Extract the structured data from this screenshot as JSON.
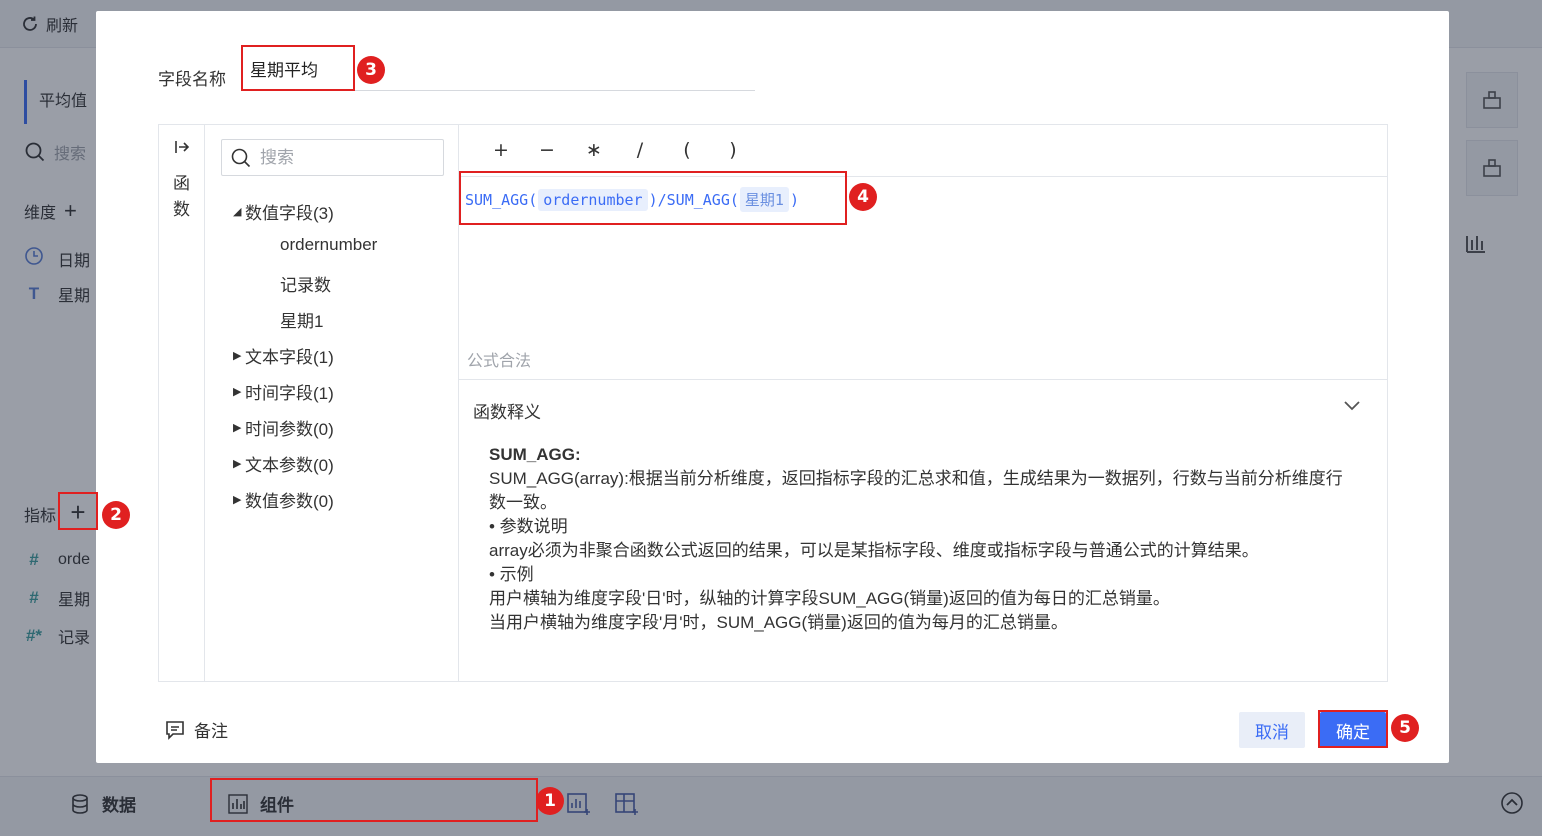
{
  "background": {
    "refresh_label": "刷新",
    "tab_label": "平均值",
    "search_placeholder": "搜索",
    "dimension_label": "维度",
    "dimension_fields": [
      {
        "icon": "clock-icon",
        "label": "日期"
      },
      {
        "icon": "text-type-icon",
        "label": "星期"
      }
    ],
    "measure_label": "指标",
    "measure_fields": [
      {
        "icon": "number-icon",
        "label": "orde"
      },
      {
        "icon": "number-icon",
        "label": "星期"
      },
      {
        "icon": "calc-number-icon",
        "label": "记录"
      }
    ],
    "bottom_data_label": "数据",
    "bottom_component_label": "组件"
  },
  "dialog": {
    "field_name_label": "字段名称",
    "field_name_value": "星期平均",
    "function_tab_label": "函数",
    "search_placeholder": "搜索",
    "tree": [
      {
        "label": "数值字段(3)",
        "expanded": true
      },
      {
        "label": "ordernumber"
      },
      {
        "label": "记录数"
      },
      {
        "label": "星期1"
      },
      {
        "label": "文本字段(1)"
      },
      {
        "label": "时间字段(1)"
      },
      {
        "label": "时间参数(0)"
      },
      {
        "label": "文本参数(0)"
      },
      {
        "label": "数值参数(0)"
      }
    ],
    "operators": [
      "+",
      "−",
      "∗",
      "/",
      "(",
      ")"
    ],
    "formula": {
      "fn1": "SUM_AGG(",
      "arg1": "ordernumber",
      "mid": ")/SUM_AGG(",
      "arg2": "星期1",
      "end": ")"
    },
    "formula_status": "公式合法",
    "explain_title": "函数释义",
    "explain": {
      "name": "SUM_AGG:",
      "line1": "SUM_AGG(array):根据当前分析维度，返回指标字段的汇总求和值，生成结果为一数据列，行数与当前分析维度行数一致。",
      "param_head": "• 参数说明",
      "param_text": "array必须为非聚合函数公式返回的结果，可以是某指标字段、维度或指标字段与普通公式的计算结果。",
      "example_head": "• 示例",
      "example1": "用户横轴为维度字段'日'时，纵轴的计算字段SUM_AGG(销量)返回的值为每日的汇总销量。",
      "example2": "当用户横轴为维度字段'月'时，SUM_AGG(销量)返回的值为每月的汇总销量。"
    },
    "note_label": "备注",
    "cancel_label": "取消",
    "ok_label": "确定"
  },
  "badges": [
    "1",
    "2",
    "3",
    "4",
    "5"
  ],
  "colors": {
    "accent": "#3b6cf5",
    "highlight": "#e02020"
  }
}
